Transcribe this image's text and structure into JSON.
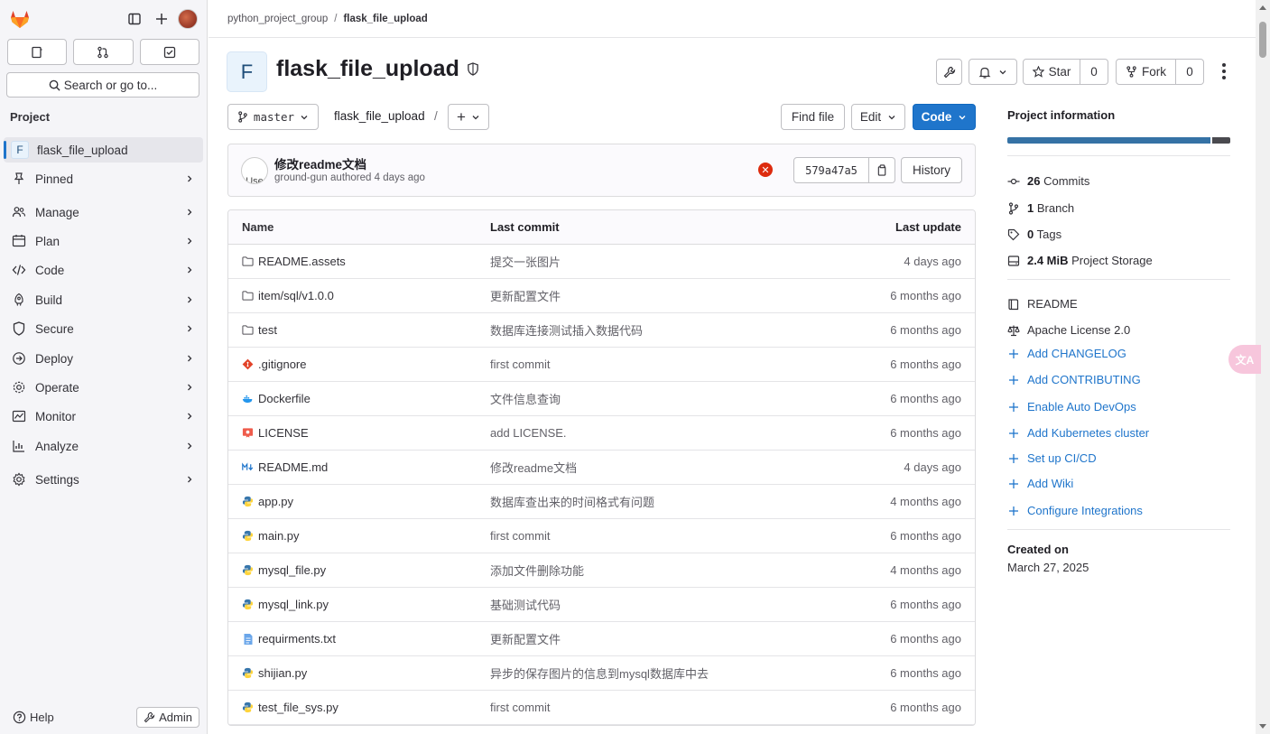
{
  "sidebar": {
    "search_label": "Search or go to...",
    "section_title": "Project",
    "project": {
      "badge": "F",
      "name": "flask_file_upload"
    },
    "items": [
      {
        "label": "Pinned",
        "icon": "pin-icon"
      },
      {
        "label": "Manage",
        "icon": "users-icon"
      },
      {
        "label": "Plan",
        "icon": "planning-icon"
      },
      {
        "label": "Code",
        "icon": "code-icon"
      },
      {
        "label": "Build",
        "icon": "rocket-icon"
      },
      {
        "label": "Secure",
        "icon": "shield-icon"
      },
      {
        "label": "Deploy",
        "icon": "deployments-icon"
      },
      {
        "label": "Operate",
        "icon": "cloud-gear-icon"
      },
      {
        "label": "Monitor",
        "icon": "monitor-icon"
      },
      {
        "label": "Analyze",
        "icon": "chart-icon"
      },
      {
        "label": "Settings",
        "icon": "settings-icon"
      }
    ],
    "help_label": "Help",
    "admin_label": "Admin"
  },
  "breadcrumb": {
    "group": "python_project_group",
    "separator": "/",
    "project": "flask_file_upload"
  },
  "header": {
    "avatar_letter": "F",
    "title": "flask_file_upload",
    "star_label": "Star",
    "star_count": "0",
    "fork_label": "Fork",
    "fork_count": "0"
  },
  "toolbar": {
    "branch": "master",
    "path": "flask_file_upload",
    "path_sep": "/",
    "add_label": "+",
    "find_file": "Find file",
    "edit": "Edit",
    "code": "Code"
  },
  "commit": {
    "avatar_text": "Use",
    "title": "修改readme文档",
    "author": "ground-gun",
    "authored": "authored",
    "time": "4 days ago",
    "sha": "579a47a5",
    "history": "History"
  },
  "files": {
    "headers": {
      "name": "Name",
      "commit": "Last commit",
      "update": "Last update"
    },
    "rows": [
      {
        "name": "README.assets",
        "type": "folder",
        "commit": "提交一张图片",
        "update": "4 days ago"
      },
      {
        "name": "item/sql/v1.0.0",
        "type": "folder",
        "commit": "更新配置文件",
        "update": "6 months ago"
      },
      {
        "name": "test",
        "type": "folder",
        "commit": "数据库连接测试插入数据代码",
        "update": "6 months ago"
      },
      {
        "name": ".gitignore",
        "type": "git",
        "commit": "first commit",
        "update": "6 months ago"
      },
      {
        "name": "Dockerfile",
        "type": "docker",
        "commit": "文件信息查询",
        "update": "6 months ago"
      },
      {
        "name": "LICENSE",
        "type": "license",
        "commit": "add LICENSE.",
        "update": "6 months ago"
      },
      {
        "name": "README.md",
        "type": "markdown",
        "commit": "修改readme文档",
        "update": "4 days ago"
      },
      {
        "name": "app.py",
        "type": "python",
        "commit": "数据库查出来的时间格式有问题",
        "update": "4 months ago"
      },
      {
        "name": "main.py",
        "type": "python",
        "commit": "first commit",
        "update": "6 months ago"
      },
      {
        "name": "mysql_file.py",
        "type": "python",
        "commit": "添加文件删除功能",
        "update": "4 months ago"
      },
      {
        "name": "mysql_link.py",
        "type": "python",
        "commit": "基础测试代码",
        "update": "6 months ago"
      },
      {
        "name": "requirments.txt",
        "type": "text",
        "commit": "更新配置文件",
        "update": "6 months ago"
      },
      {
        "name": "shijian.py",
        "type": "python",
        "commit": "异步的保存图片的信息到mysql数据库中去",
        "update": "6 months ago"
      },
      {
        "name": "test_file_sys.py",
        "type": "python",
        "commit": "first commit",
        "update": "6 months ago"
      }
    ]
  },
  "info": {
    "title": "Project information",
    "language_colors": [
      "#3572a5",
      "#4a4a4f"
    ],
    "language_shares": [
      0.92,
      0.08
    ],
    "commits_count": "26",
    "commits_label": "Commits",
    "branch_count": "1",
    "branch_label": "Branch",
    "tags_count": "0",
    "tags_label": "Tags",
    "storage_size": "2.4 MiB",
    "storage_label": "Project Storage",
    "readme": "README",
    "license": "Apache License 2.0",
    "links": [
      "Add CHANGELOG",
      "Add CONTRIBUTING",
      "Enable Auto DevOps",
      "Add Kubernetes cluster",
      "Set up CI/CD",
      "Add Wiki",
      "Configure Integrations"
    ],
    "created_label": "Created on",
    "created_date": "March 27, 2025"
  },
  "colors": {
    "primary": "#1f75cb",
    "danger": "#dd2b0e",
    "link": "#1f75cb"
  }
}
